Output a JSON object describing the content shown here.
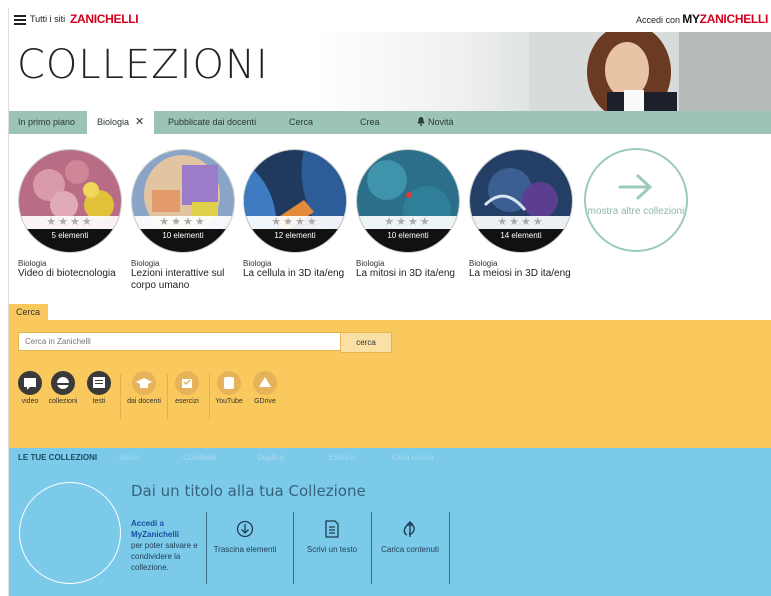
{
  "header": {
    "all_sites": "Tutti i siti",
    "brand": "ZANICHELLI",
    "login": "Accedi con",
    "my_brand_prefix": "MY",
    "my_brand": "ZANICHELLI"
  },
  "hero": {
    "title": "COLLEZIONI"
  },
  "tabs": [
    {
      "label": "In primo piano"
    },
    {
      "label": "Biologia",
      "close": "✕"
    },
    {
      "label": "Pubblicate dai docenti"
    },
    {
      "label": "Cerca"
    },
    {
      "label": "Crea"
    },
    {
      "label": "Novità",
      "icon": "bell-icon"
    }
  ],
  "collections": [
    {
      "category": "Biologia",
      "name": "Video di biotecnologia",
      "count": "5 elementi",
      "stars": "★★★★",
      "color": "#c98a9a"
    },
    {
      "category": "Biologia",
      "name": "Lezioni interattive sul corpo umano",
      "count": "10 elementi",
      "stars": "★★★★",
      "color": "#d8b48e"
    },
    {
      "category": "Biologia",
      "name": "La cellula in 3D ita/eng",
      "count": "12 elementi",
      "stars": "★★★★",
      "color": "#3a6aa0"
    },
    {
      "category": "Biologia",
      "name": "La mitosi in 3D ita/eng",
      "count": "10 elementi",
      "stars": "★★★★",
      "color": "#3e86a0"
    },
    {
      "category": "Biologia",
      "name": "La meiosi in 3D ita/eng",
      "count": "14 elementi",
      "stars": "★★★★",
      "color": "#2e5f86"
    }
  ],
  "more": {
    "label": "mostra altre collezioni"
  },
  "search": {
    "tab": "Cerca",
    "placeholder": "Cerca in Zanichelli",
    "button": "cerca",
    "filters": [
      {
        "label": "video",
        "icon": "video-icon"
      },
      {
        "label": "collezioni",
        "icon": "collections-icon"
      },
      {
        "label": "testi",
        "icon": "texts-icon"
      },
      {
        "label": "dai docenti",
        "icon": "teachers-icon"
      },
      {
        "label": "esercizi",
        "icon": "exercises-icon"
      },
      {
        "label": "YouTube",
        "icon": "youtube-icon"
      },
      {
        "label": "GDrive",
        "icon": "gdrive-icon"
      }
    ]
  },
  "my_collections": {
    "title": "LE TUE COLLEZIONI",
    "actions": [
      "Salva",
      "Condividi",
      "Duplica",
      "Elimina",
      "Crea nuova"
    ],
    "placeholder_title": "Dai un titolo alla tua Collezione",
    "login_link": "Accedi a MyZanichelli",
    "login_text": "per poter salvare e condividere la collezione.",
    "tools": [
      {
        "label": "Trascina elementi",
        "icon": "drag-icon"
      },
      {
        "label": "Scrivi un testo",
        "icon": "document-icon"
      },
      {
        "label": "Carica contenuti",
        "icon": "upload-icon"
      }
    ]
  }
}
